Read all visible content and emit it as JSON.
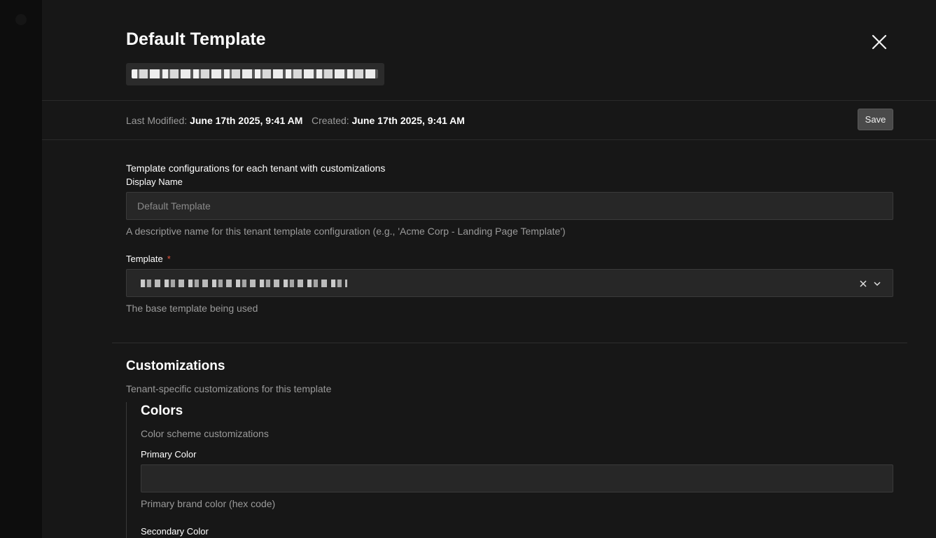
{
  "drawer": {
    "title": "Default Template",
    "close_label": "×"
  },
  "meta": {
    "modified_label": "Last Modified:",
    "modified_value": "June 17th 2025, 9:41 AM",
    "created_label": "Created:",
    "created_value": "June 17th 2025, 9:41 AM",
    "save_label": "Save"
  },
  "form": {
    "description": "Template configurations for each tenant with customizations",
    "display_name": {
      "label": "Display Name",
      "placeholder": "Default Template",
      "help": "A descriptive name for this tenant template configuration (e.g., 'Acme Corp - Landing Page Template')"
    },
    "template": {
      "label": "Template",
      "required_mark": "*",
      "help": "The base template being used"
    }
  },
  "customizations": {
    "title": "Customizations",
    "description": "Tenant-specific customizations for this template",
    "colors": {
      "title": "Colors",
      "description": "Color scheme customizations",
      "primary": {
        "label": "Primary Color",
        "value": "",
        "help": "Primary brand color (hex code)"
      },
      "secondary": {
        "label": "Secondary Color"
      }
    }
  },
  "colors": {
    "panel_bg": "#171717",
    "input_bg": "#272727",
    "accent_tab": "#2f6fd8",
    "required": "#e0533d"
  }
}
